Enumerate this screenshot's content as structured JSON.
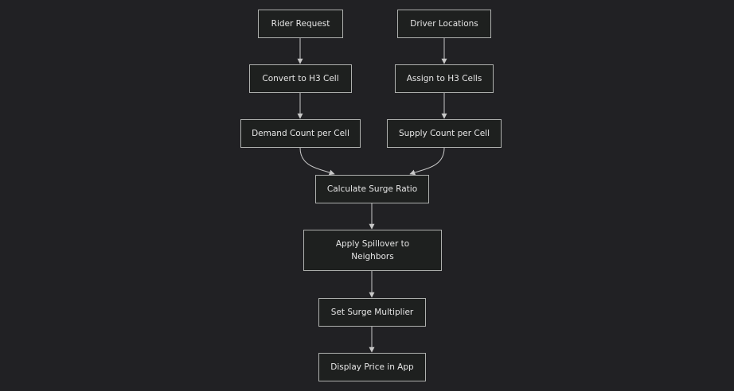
{
  "diagram": {
    "nodes": {
      "rider_request": "Rider Request",
      "driver_locations": "Driver Locations",
      "convert_h3": "Convert to H3 Cell",
      "assign_h3": "Assign to H3 Cells",
      "demand_count": "Demand Count per Cell",
      "supply_count": "Supply Count per Cell",
      "surge_ratio": "Calculate Surge Ratio",
      "spillover": "Apply Spillover to Neighbors",
      "surge_multiplier": "Set Surge Multiplier",
      "display_price": "Display Price in App"
    },
    "edges": [
      [
        "rider_request",
        "convert_h3"
      ],
      [
        "driver_locations",
        "assign_h3"
      ],
      [
        "convert_h3",
        "demand_count"
      ],
      [
        "assign_h3",
        "supply_count"
      ],
      [
        "demand_count",
        "surge_ratio"
      ],
      [
        "supply_count",
        "surge_ratio"
      ],
      [
        "surge_ratio",
        "spillover"
      ],
      [
        "spillover",
        "surge_multiplier"
      ],
      [
        "surge_multiplier",
        "display_price"
      ]
    ],
    "colors": {
      "background": "#212124",
      "node_fill": "#1e201f",
      "node_border": "#aeb0ae",
      "text": "#e6e6e6",
      "edge": "#c8c8c8"
    }
  }
}
